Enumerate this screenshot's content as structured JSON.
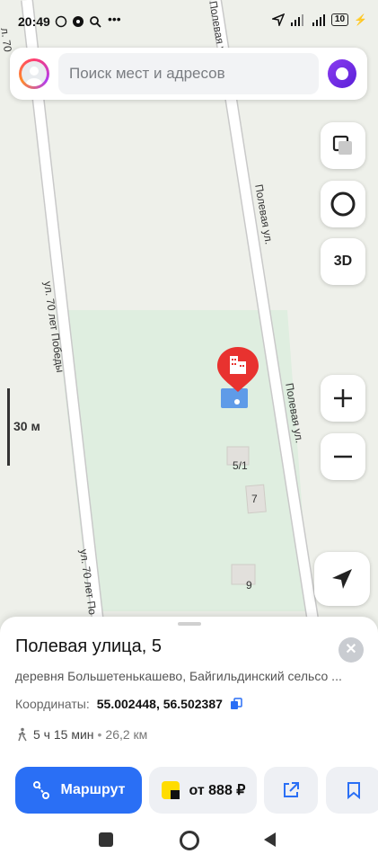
{
  "status_bar": {
    "time": "20:49",
    "battery": "10"
  },
  "search": {
    "placeholder": "Поиск мест и адресов"
  },
  "map": {
    "streets": [
      "ул. 70 лет Победы",
      "Полевая ул.",
      "Полевая ул",
      "ул. 70 лет По"
    ],
    "house_numbers": [
      "5/1",
      "7",
      "9"
    ],
    "scale_label": "30 м",
    "edge_labels": {
      "top_left_street": "л. 70",
      "top_right_street": "Полевая ул"
    }
  },
  "controls": {
    "three_d_label": "3D"
  },
  "place": {
    "title": "Полевая улица, 5",
    "address": "деревня Большетенькашево, Байгильдинский сельсо ...",
    "coords_label": "Координаты:",
    "coords_value": "55.002448, 56.502387",
    "walk_time": "5 ч 15 мин",
    "walk_separator": "•",
    "walk_distance": "26,2 км"
  },
  "actions": {
    "route_label": "Маршрут",
    "taxi_label": "от 888 ₽"
  },
  "colors": {
    "accent": "#2a6ff5",
    "marker": "#e8322f",
    "map_bg": "#eef0ea",
    "green_area": "#dfeee0"
  }
}
